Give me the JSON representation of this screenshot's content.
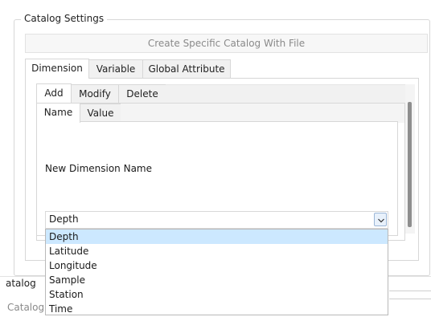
{
  "group": {
    "title": "Catalog Settings"
  },
  "create_button": "Create Specific Catalog With File",
  "tabs_main": [
    "Dimension",
    "Variable",
    "Global Attribute"
  ],
  "tabs_action": [
    "Add",
    "Modify",
    "Delete"
  ],
  "tabs_field": [
    "Name",
    "Value"
  ],
  "field_label": "New Dimension Name",
  "combo": {
    "selected": "Depth"
  },
  "dropdown_options": [
    "Depth",
    "Latitude",
    "Longitude",
    "Sample",
    "Station",
    "Time"
  ],
  "dropdown_highlighted": "Depth",
  "lower": {
    "fragment_1": "atalog",
    "fragment_2": "Catalog"
  },
  "icons": {
    "dropdown": "chevron-down-icon"
  }
}
